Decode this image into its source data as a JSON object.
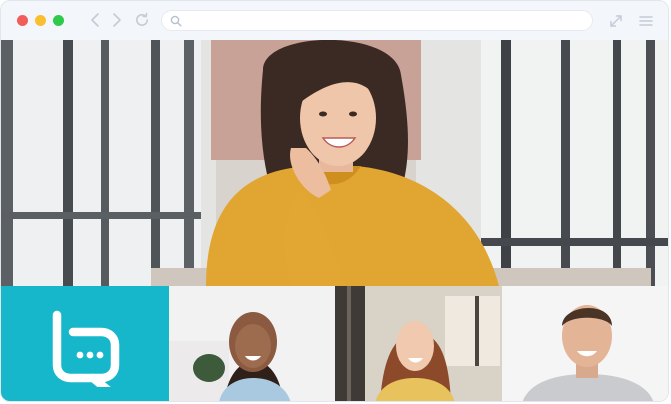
{
  "browser": {
    "address_value": "",
    "address_placeholder": "",
    "icons": {
      "back": "chevron-left-icon",
      "forward": "chevron-right-icon",
      "reload": "reload-icon",
      "search": "search-icon",
      "expand": "expand-icon",
      "menu": "hamburger-menu-icon"
    },
    "colors": {
      "close": "#f25d5b",
      "minimize": "#f8bf2f",
      "maximize": "#2fca4a",
      "chrome_bg": "#f3f6fa",
      "icon": "#c4ccd6"
    }
  },
  "call": {
    "main_speaker": "speaker-main",
    "participants": [
      "participant-1",
      "participant-2",
      "participant-3"
    ],
    "brand": {
      "logo_icon": "chat-bubble-logo-icon",
      "color": "#17b7cb"
    }
  }
}
